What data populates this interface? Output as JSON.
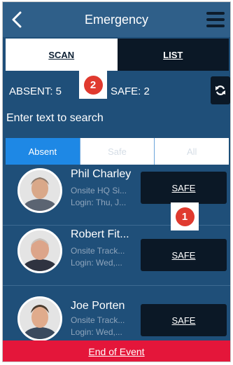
{
  "header": {
    "title": "Emergency",
    "back_icon": "chevron-left-icon",
    "menu_icon": "hamburger-icon"
  },
  "segment": {
    "scan_label": "SCAN",
    "list_label": "LIST",
    "active": "SCAN"
  },
  "counts": {
    "absent_label": "ABSENT: 5",
    "safe_label": "SAFE: 2",
    "refresh_icon": "refresh-icon"
  },
  "search": {
    "placeholder": "Enter text to search",
    "value": ""
  },
  "filters": {
    "absent": "Absent",
    "safe": "Safe",
    "all": "All",
    "active": "Absent"
  },
  "people": [
    {
      "name": "Phil Charley",
      "location": "Onsite HQ Si...",
      "login": "Login: Thu, J...",
      "action": "SAFE"
    },
    {
      "name": "Robert Fit...",
      "location": "Onsite Track...",
      "login": "Login: Wed,...",
      "action": "SAFE"
    },
    {
      "name": "Joe Porten",
      "location": "Onsite Track...",
      "login": "Login: Wed,...",
      "action": "SAFE"
    }
  ],
  "badges": {
    "one": "1",
    "two": "2"
  },
  "footer": {
    "label": "End of Event"
  },
  "colors": {
    "background": "#1f4f79",
    "header": "#2f5f89",
    "dark_button": "#0b1826",
    "accent_blue": "#1e88e5",
    "footer_red": "#e4163a",
    "badge_red": "#e03a2f"
  }
}
